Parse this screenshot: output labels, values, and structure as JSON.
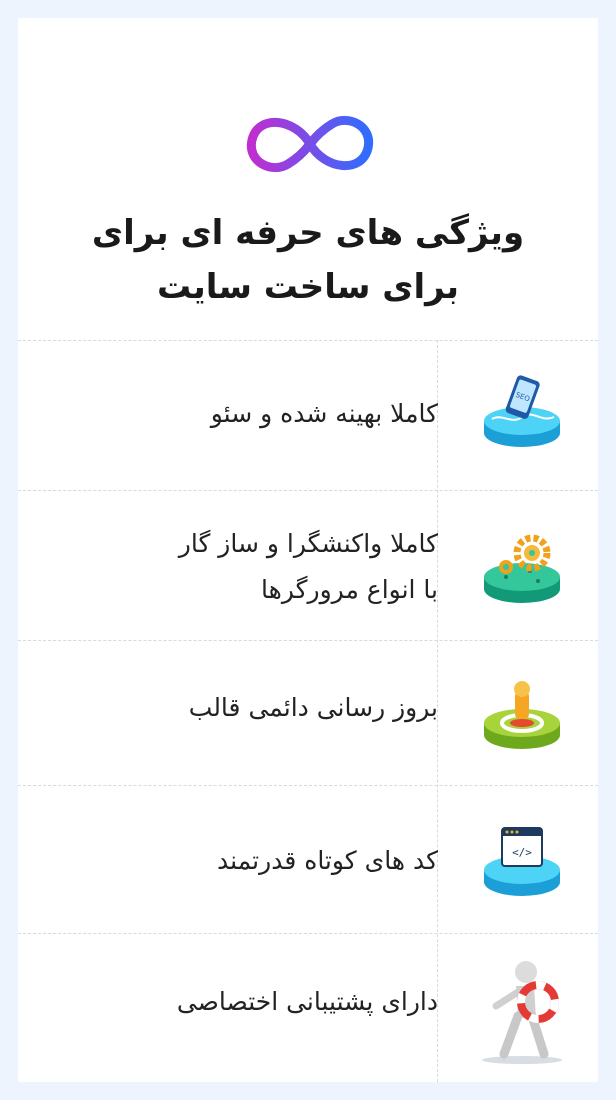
{
  "header": {
    "title_line1": "ویژگی های حرفه ای برای",
    "title_line2": "برای ساخت سایت"
  },
  "colors": {
    "infinity_gradient": [
      "#c02ed0",
      "#2f6dff"
    ],
    "page_background": "#eef4fd",
    "divider": "#d4d9e2"
  },
  "features": [
    {
      "icon": "seo-phone-icon",
      "text": "کاملا بهینه شده و سئو"
    },
    {
      "icon": "gears-icon",
      "text_line1": "کاملا واکنشگرا و ساز گار",
      "text_line2": "با انواع مرورگرها"
    },
    {
      "icon": "update-refresh-icon",
      "text": "بروز رسانی دائمی قالب"
    },
    {
      "icon": "code-window-icon",
      "text": "کد های کوتاه قدرتمند"
    },
    {
      "icon": "support-runner-icon",
      "text": "دارای پشتیبانی اختصاصی"
    }
  ]
}
